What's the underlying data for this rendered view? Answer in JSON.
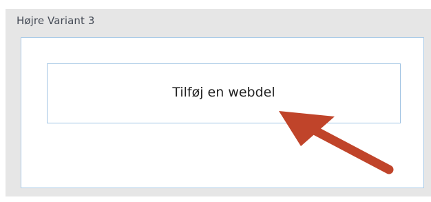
{
  "zone": {
    "title": "Højre Variant 3",
    "add_webpart_label": "Tilføj en webdel"
  },
  "annotation": {
    "arrow_color": "#c0442a",
    "arrow_icon": "arrow-pointer-icon"
  },
  "colors": {
    "zone_background": "#e6e6e6",
    "border_accent": "#a9cbe8"
  }
}
